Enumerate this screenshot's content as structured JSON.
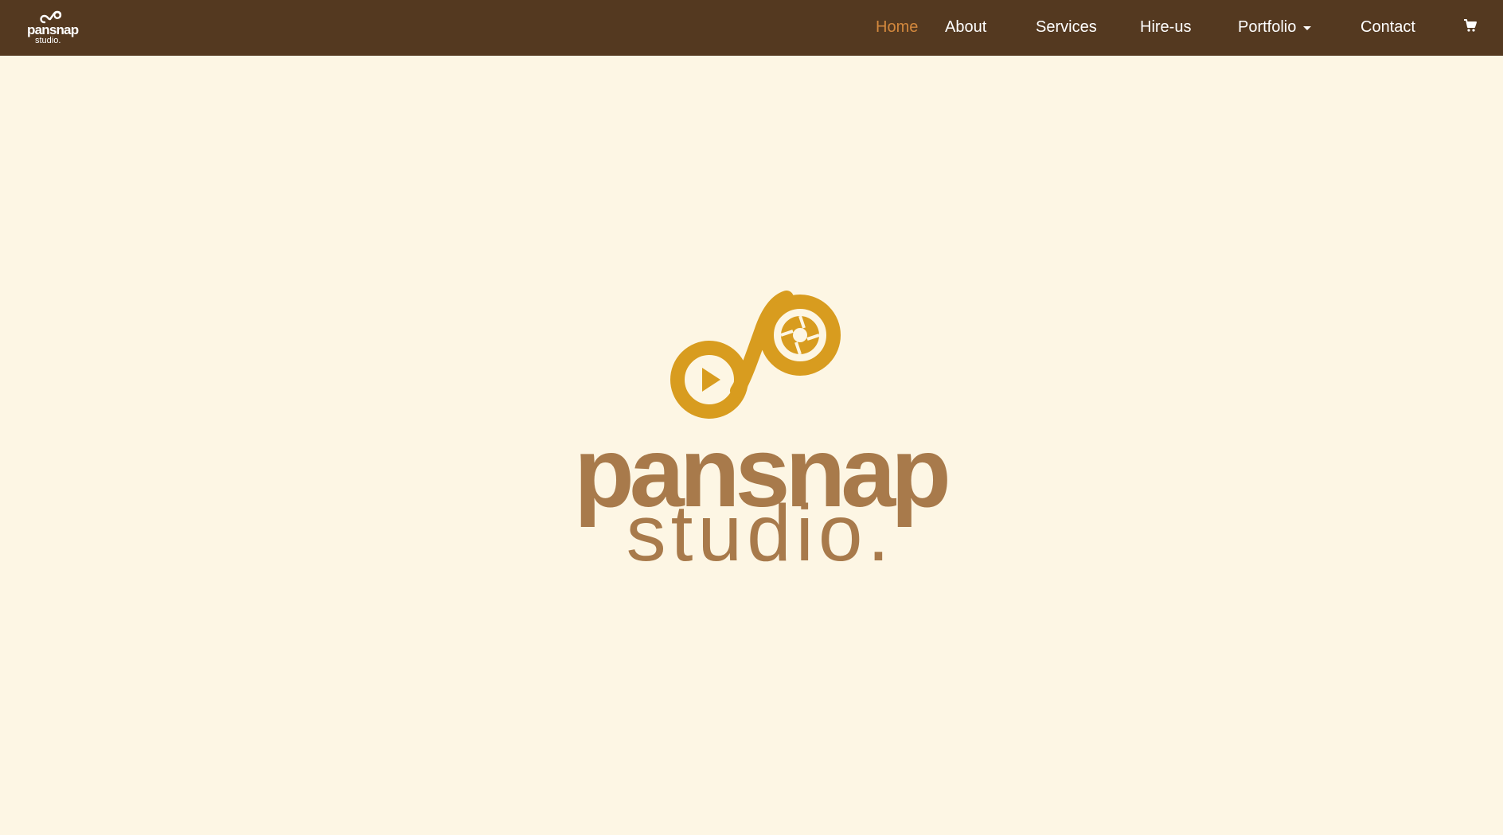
{
  "brand": {
    "name": "pansnap",
    "sub": "studio."
  },
  "nav": {
    "home": "Home",
    "about": "About",
    "services": "Services",
    "hire": "Hire-us",
    "portfolio": "Portfolio",
    "contact": "Contact",
    "cart_icon": "shopping-cart-icon"
  },
  "hero": {
    "word": "pansnap",
    "sub": "studio."
  },
  "colors": {
    "navbar": "#543920",
    "background": "#fdf6e4",
    "active_nav": "#d3883d",
    "logo_gold": "#d89c1f",
    "logo_brown": "#a87a4b"
  }
}
